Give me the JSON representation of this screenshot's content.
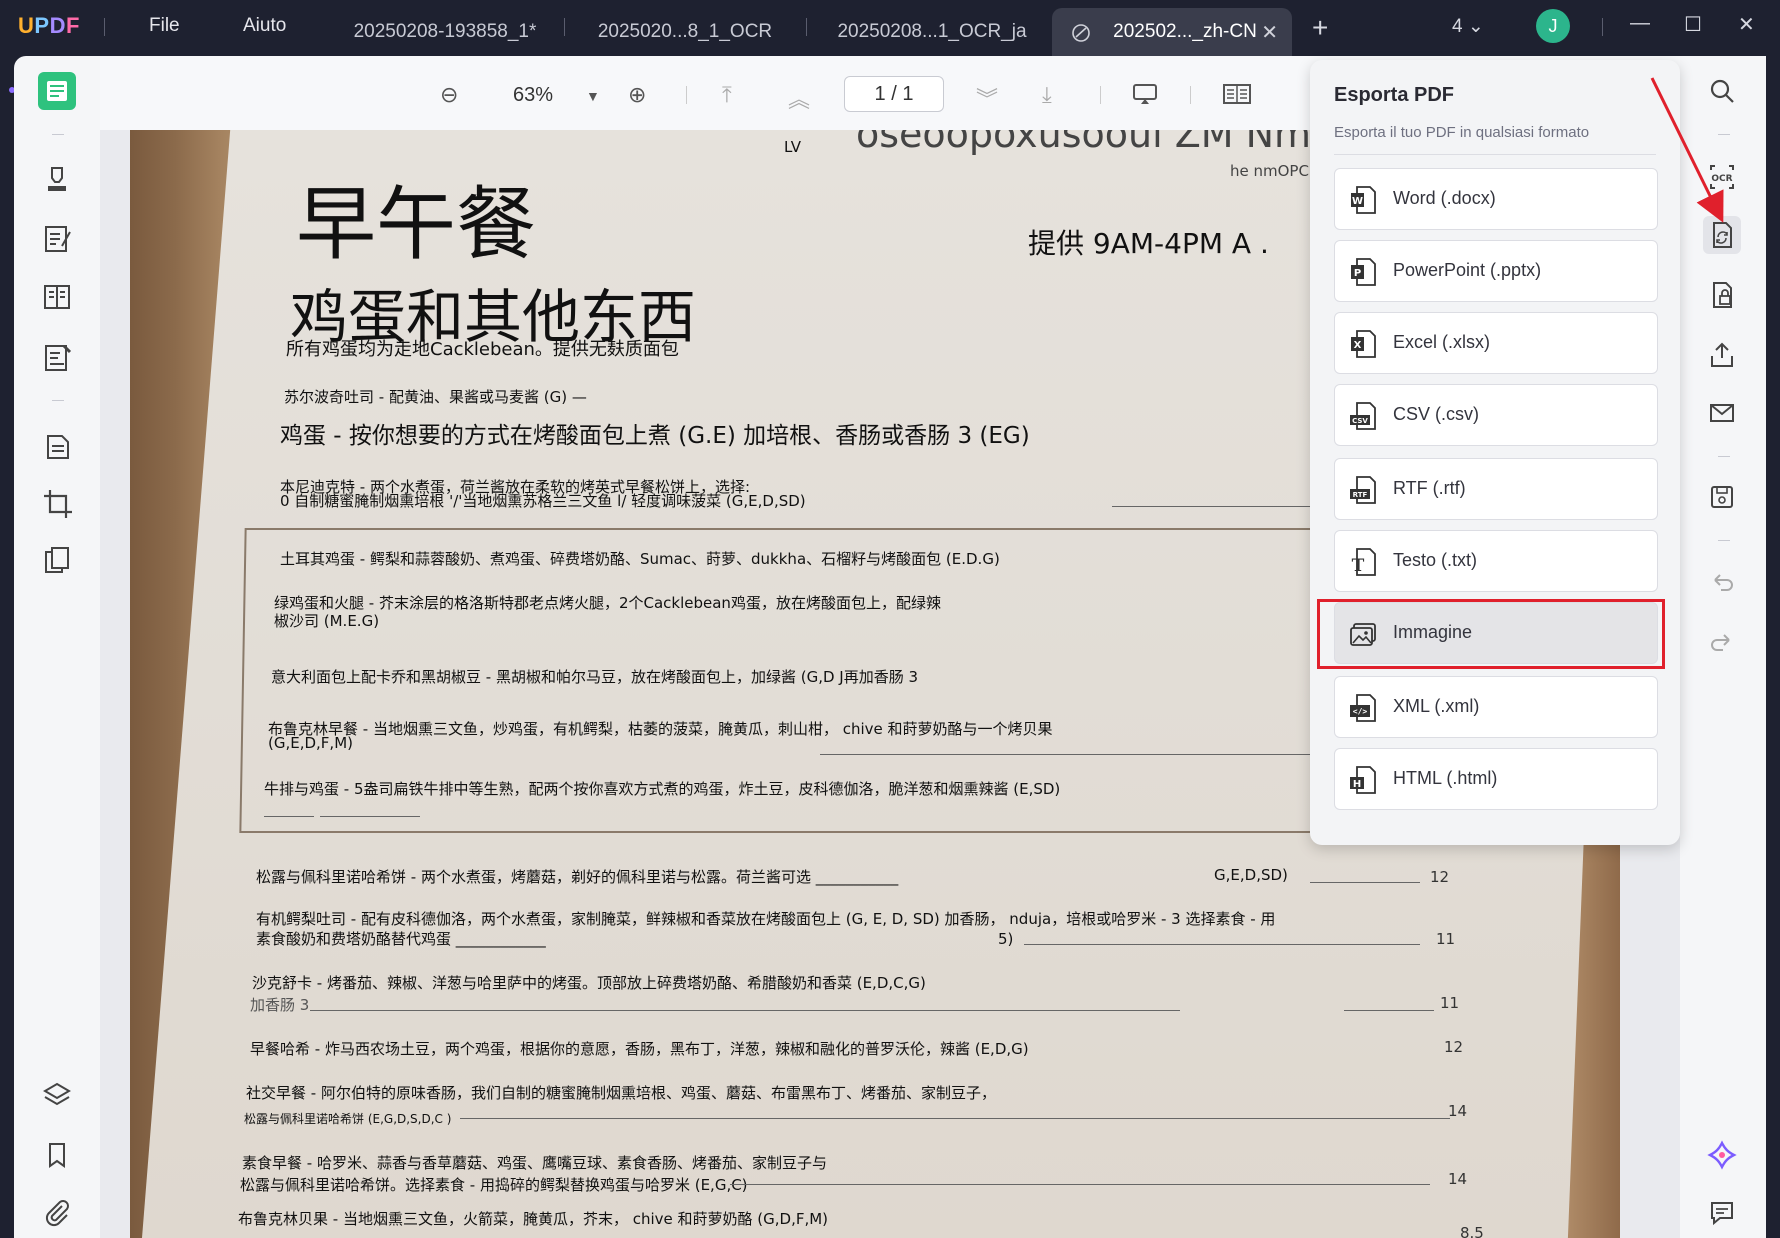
{
  "app": {
    "logo": "UPDF",
    "menus": [
      "File",
      "Aiuto"
    ],
    "tabs": [
      {
        "label": "20250208-193858_1*"
      },
      {
        "label": "2025020...8_1_OCR"
      },
      {
        "label": "20250208...1_OCR_ja"
      },
      {
        "label": "202502..._zh-CN"
      }
    ],
    "tab_count": "4",
    "avatar_letter": "J"
  },
  "toolbar": {
    "zoom": "63%",
    "page_current": "1",
    "page_sep": "/",
    "page_total": "1"
  },
  "export_panel": {
    "title": "Esporta PDF",
    "subtitle": "Esporta il tuo PDF in qualsiasi formato",
    "options": [
      {
        "label": "Word (.docx)",
        "icon": "word-icon"
      },
      {
        "label": "PowerPoint (.pptx)",
        "icon": "powerpoint-icon"
      },
      {
        "label": "Excel (.xlsx)",
        "icon": "excel-icon"
      },
      {
        "label": "CSV (.csv)",
        "icon": "csv-icon"
      },
      {
        "label": "RTF (.rtf)",
        "icon": "rtf-icon"
      },
      {
        "label": "Testo (.txt)",
        "icon": "text-icon"
      },
      {
        "label": "Immagine",
        "icon": "image-icon",
        "selected": true
      },
      {
        "label": "XML (.xml)",
        "icon": "xml-icon"
      },
      {
        "label": "HTML (.html)",
        "icon": "html-icon"
      }
    ]
  },
  "document": {
    "top_fragment_1": "LV",
    "top_fragment_2": "he nmOPC",
    "top_fragment_3": "oseoopoxusooui ZM  Nm",
    "heading": "早午餐",
    "hours": "提供 9AM-4PM A .",
    "subheading": "鸡蛋和其他东西",
    "note": "所有鸡蛋均为走地Cacklebean。提供无麸质面包",
    "lines": [
      "苏尔波奇吐司 - 配黄油、果酱或马麦酱 (G) —",
      "鸡蛋 - 按你想要的方式在烤酸面包上煮 (G.E) 加培根、香肠或香肠 3 (EG)",
      "本尼迪克特 - 两个水煮蛋，荷兰酱放在柔软的烤英式早餐松饼上，选择:",
      "0 自制糖蜜腌制烟熏培根 '/'当地烟熏苏格兰三文鱼 l/ 轻度调味菠菜 (G,E,D,SD)",
      "土耳其鸡蛋 - 鳄梨和蒜蓉酸奶、煮鸡蛋、碎费塔奶酪、Sumac、莳萝、dukkha、石榴籽与烤酸面包 (E.D.G)",
      "绿鸡蛋和火腿 - 芥末涂层的格洛斯特郡老点烤火腿，2个Cacklebean鸡蛋，放在烤酸面包上，配绿辣",
      "椒沙司 (M.E.G)",
      "意大利面包上配卡乔和黑胡椒豆 - 黑胡椒和帕尔马豆，放在烤酸面包上，加绿酱 (G,D J再加香肠 3",
      "布鲁克林早餐 - 当地烟熏三文鱼，炒鸡蛋，有机鳄梨，枯萎的菠菜，腌黄瓜，刺山柑， chive 和莳萝奶酪与一个烤贝果",
      "(G,E,D,F,M)",
      "牛排与鸡蛋 - 5盎司扁铁牛排中等生熟，配两个按你喜欢方式煮的鸡蛋，炸土豆，皮科德伽洛，脆洋葱和烟熏辣酱 (E,SD)",
      "松露与佩科里诺哈希饼 - 两个水煮蛋，烤蘑菇，剃好的佩科里诺与松露。荷兰酱可选 ___________",
      "有机鳄梨吐司 - 配有皮科德伽洛，两个水煮蛋，家制腌菜，鲜辣椒和香菜放在烤酸面包上 (G, E, D, SD) 加香肠， nduja，培根或哈罗米 - 3 选择素食 - 用",
      "素食酸奶和费塔奶酪替代鸡蛋 ____________",
      "沙克舒卡 - 烤番茄、辣椒、洋葱与哈里萨中的烤蛋。顶部放上碎费塔奶酪、希腊酸奶和香菜 (E,D,C,G)",
      "加香肠 3",
      "早餐哈希 - 炸马西农场土豆，两个鸡蛋，根据你的意愿，香肠，黑布丁，洋葱，辣椒和融化的普罗沃伦，辣酱 (E,D,G)",
      "社交早餐 - 阿尔伯特的原味香肠，我们自制的糖蜜腌制烟熏培根、鸡蛋、蘑菇、布雷黑布丁、烤番茄、家制豆子，",
      "松露与佩科里诺哈希饼 (E,G,D,S,D,C )",
      "素食早餐 - 哈罗米、蒜香与香草蘑菇、鸡蛋、鹰嘴豆球、素食香肠、烤番茄、家制豆子与",
      "松露与佩科里诺哈希饼。选择素食 - 用捣碎的鳄梨替换鸡蛋与哈罗米 (E,G,C)",
      "布鲁克林贝果 - 当地烟熏三文鱼，火箭菜，腌黄瓜，芥末， chive 和莳萝奶酪 (G,D,F,M)"
    ],
    "fragment_gedsd": "G,E,D,SD)",
    "fragment_5": "5)",
    "prices": [
      "12",
      "11",
      "11",
      "12",
      "14",
      "14",
      "8.5"
    ]
  }
}
